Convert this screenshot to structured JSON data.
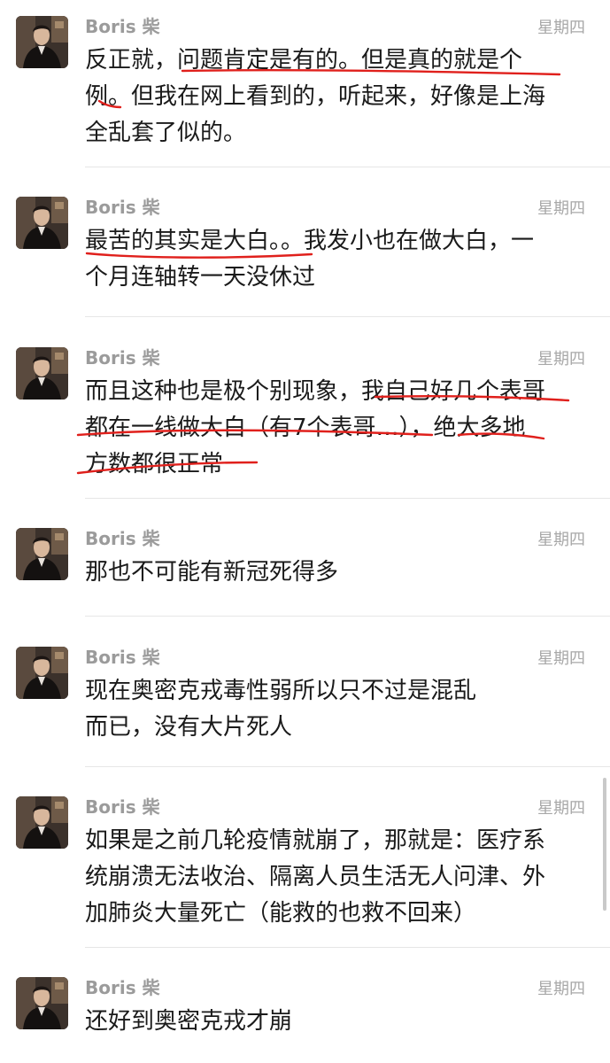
{
  "chat": {
    "messages": [
      {
        "sender": "Boris 柴",
        "time": "星期四",
        "lines": [
          "反正就，问题肯定是有的。但是真的就是个",
          "例。但我在网上看到的，听起来，好像是上海",
          "全乱套了似的。"
        ]
      },
      {
        "sender": "Boris 柴",
        "time": "星期四",
        "lines": [
          "最苦的其实是大白。。我发小也在做大白，一",
          "个月连轴转一天没休过"
        ]
      },
      {
        "sender": "Boris 柴",
        "time": "星期四",
        "lines": [
          "而且这种也是极个别现象，我自己好几个表哥",
          "都在一线做大白（有7个表哥…），绝大多地",
          "方数都很正常"
        ]
      },
      {
        "sender": "Boris 柴",
        "time": "星期四",
        "lines": [
          "那也不可能有新冠死得多"
        ]
      },
      {
        "sender": "Boris 柴",
        "time": "星期四",
        "lines": [
          "现在奥密克戎毒性弱所以只不过是混乱",
          "而已，没有大片死人"
        ]
      },
      {
        "sender": "Boris 柴",
        "time": "星期四",
        "lines": [
          "如果是之前几轮疫情就崩了，那就是：医疗系",
          "统崩溃无法收治、隔离人员生活无人问津、外",
          "加肺炎大量死亡（能救的也救不回来）"
        ]
      },
      {
        "sender": "Boris 柴",
        "time": "星期四",
        "lines": [
          "还好到奥密克戎才崩"
        ]
      }
    ]
  },
  "colors": {
    "annotation_ink": "#e0201c",
    "sender_name": "#9b9b9b",
    "message_text": "#1a1a1a"
  }
}
